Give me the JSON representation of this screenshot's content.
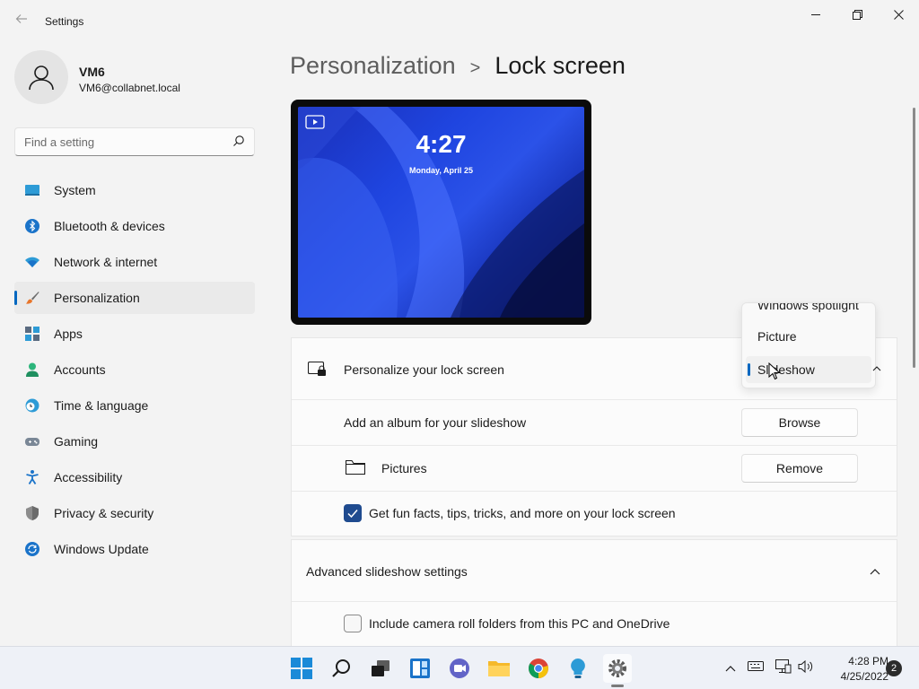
{
  "window": {
    "app_title": "Settings",
    "back_icon": "arrow-left-icon",
    "controls": [
      "minimize",
      "maximize",
      "close"
    ]
  },
  "profile": {
    "name": "VM6",
    "email": "VM6@collabnet.local"
  },
  "search": {
    "placeholder": "Find a setting"
  },
  "sidebar": {
    "items": [
      {
        "label": "System",
        "icon": "monitor-icon",
        "selected": false
      },
      {
        "label": "Bluetooth & devices",
        "icon": "bluetooth-icon",
        "selected": false
      },
      {
        "label": "Network & internet",
        "icon": "wifi-icon",
        "selected": false
      },
      {
        "label": "Personalization",
        "icon": "brush-icon",
        "selected": true
      },
      {
        "label": "Apps",
        "icon": "apps-icon",
        "selected": false
      },
      {
        "label": "Accounts",
        "icon": "person-icon",
        "selected": false
      },
      {
        "label": "Time & language",
        "icon": "globe-clock-icon",
        "selected": false
      },
      {
        "label": "Gaming",
        "icon": "gamepad-icon",
        "selected": false
      },
      {
        "label": "Accessibility",
        "icon": "accessibility-icon",
        "selected": false
      },
      {
        "label": "Privacy & security",
        "icon": "shield-icon",
        "selected": false
      },
      {
        "label": "Windows Update",
        "icon": "sync-icon",
        "selected": false
      }
    ]
  },
  "breadcrumb": {
    "parent": "Personalization",
    "separator": ">",
    "current": "Lock screen"
  },
  "preview": {
    "time": "4:27",
    "date": "Monday, April 25"
  },
  "lock_screen": {
    "personalize_label": "Personalize your lock screen",
    "album_label": "Add an album for your slideshow",
    "browse_button": "Browse",
    "folder_name": "Pictures",
    "remove_button": "Remove",
    "fun_facts_label": "Get fun facts, tips, tricks, and more on your lock screen",
    "fun_facts_checked": true
  },
  "dropdown": {
    "options": [
      "Windows spotlight",
      "Picture",
      "Slideshow"
    ],
    "selected": "Slideshow"
  },
  "advanced": {
    "title": "Advanced slideshow settings",
    "expanded": true,
    "camera_roll_label": "Include camera roll folders from this PC and OneDrive",
    "camera_roll_checked": false
  },
  "taskbar": {
    "apps": [
      "start-icon",
      "search-icon",
      "task-view-icon",
      "widgets-icon",
      "teams-chat-icon",
      "file-explorer-icon",
      "chrome-icon",
      "lightbulb-icon",
      "settings-icon"
    ],
    "active_app": "settings-icon",
    "time": "4:28 PM",
    "date": "4/25/2022",
    "notification_count": "2"
  },
  "colors": {
    "accent": "#0067c0",
    "checkbox_checked": "#1f4b8f",
    "window_bg": "#f3f3f3",
    "card_bg": "#fbfbfb"
  }
}
